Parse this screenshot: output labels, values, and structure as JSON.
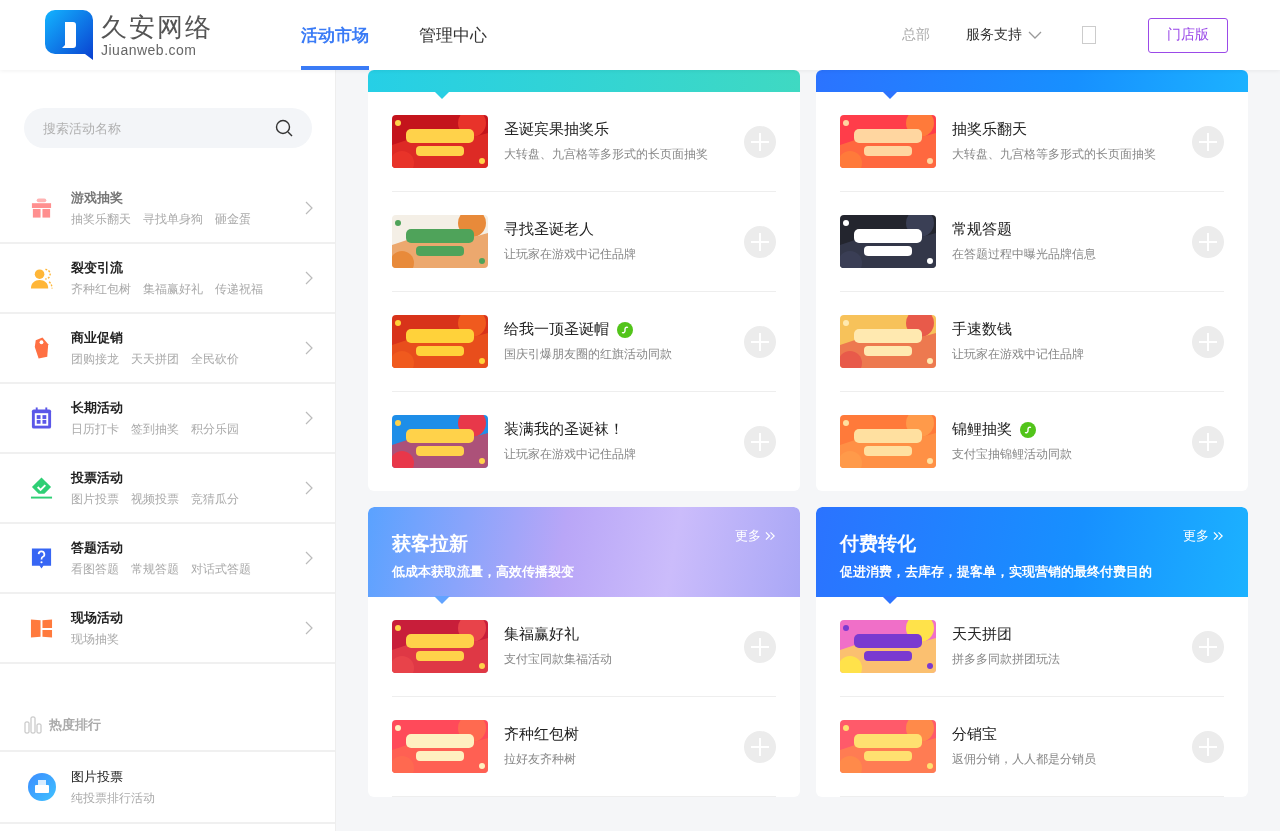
{
  "header": {
    "logo": {
      "name": "久安网络",
      "domain": "Jiuanweb.com"
    },
    "nav": [
      {
        "label": "活动市场",
        "selected": true
      },
      {
        "label": "管理中心",
        "selected": false
      }
    ],
    "org": "总部",
    "support_menu": "服务支持",
    "edition_button": "门店版"
  },
  "sidebar": {
    "search": {
      "placeholder": "搜索活动名称"
    },
    "categories": [
      {
        "kind": "gift",
        "title": "游戏抽奖",
        "tags": [
          "抽奖乐翻天",
          "寻找单身狗",
          "砸金蛋"
        ]
      },
      {
        "kind": "person",
        "title": "裂变引流",
        "tags": [
          "齐种红包树",
          "集福赢好礼",
          "传递祝福"
        ]
      },
      {
        "kind": "tag",
        "title": "商业促销",
        "tags": [
          "团购接龙",
          "天天拼团",
          "全民砍价"
        ]
      },
      {
        "kind": "calendar",
        "title": "长期活动",
        "tags": [
          "日历打卡",
          "签到抽奖",
          "积分乐园"
        ]
      },
      {
        "kind": "vote",
        "title": "投票活动",
        "tags": [
          "图片投票",
          "视频投票",
          "竞猜瓜分"
        ]
      },
      {
        "kind": "question",
        "title": "答题活动",
        "tags": [
          "看图答题",
          "常规答题",
          "对话式答题"
        ]
      },
      {
        "kind": "venue",
        "title": "现场活动",
        "tags": [
          "现场抽奖"
        ]
      }
    ],
    "ranking": {
      "title": "热度排行",
      "items": [
        {
          "title": "图片投票",
          "subtitle": "纯投票排行活动"
        }
      ]
    }
  },
  "sections": [
    {
      "kind": "teal",
      "items": [
        {
          "title": "圣诞宾果抽奖乐",
          "desc": "大转盘、九宫格等多形式的长页面抽奖",
          "mini_program": false
        },
        {
          "title": "寻找圣诞老人",
          "desc": "让玩家在游戏中记住品牌",
          "mini_program": false
        },
        {
          "title": "给我一顶圣诞帽",
          "desc": "国庆引爆朋友圈的红旗活动同款",
          "mini_program": true
        },
        {
          "title": "装满我的圣诞袜！",
          "desc": "让玩家在游戏中记住品牌",
          "mini_program": false
        }
      ]
    },
    {
      "kind": "blue",
      "items": [
        {
          "title": "抽奖乐翻天",
          "desc": "大转盘、九宫格等多形式的长页面抽奖",
          "mini_program": false
        },
        {
          "title": "常规答题",
          "desc": "在答题过程中曝光品牌信息",
          "mini_program": false
        },
        {
          "title": "手速数钱",
          "desc": "让玩家在游戏中记住品牌",
          "mini_program": false
        },
        {
          "title": "锦鲤抽奖",
          "desc": "支付宝抽锦鲤活动同款",
          "mini_program": true
        }
      ]
    },
    {
      "kind": "violet",
      "title": "获客拉新",
      "subtitle": "低成本获取流量，高效传播裂变",
      "more": "更多",
      "items": [
        {
          "title": "集福赢好礼",
          "desc": "支付宝同款集福活动",
          "mini_program": false
        },
        {
          "title": "齐种红包树",
          "desc": "拉好友齐种树",
          "mini_program": false
        }
      ]
    },
    {
      "kind": "blue",
      "title": "付费转化",
      "subtitle": "促进消费，去库存，提客单，实现营销的最终付费目的",
      "more": "更多",
      "items": [
        {
          "title": "天天拼团",
          "desc": "拼多多同款拼团玩法",
          "mini_program": false
        },
        {
          "title": "分销宝",
          "desc": "返佣分销，人人都是分销员",
          "mini_program": false
        }
      ]
    }
  ]
}
